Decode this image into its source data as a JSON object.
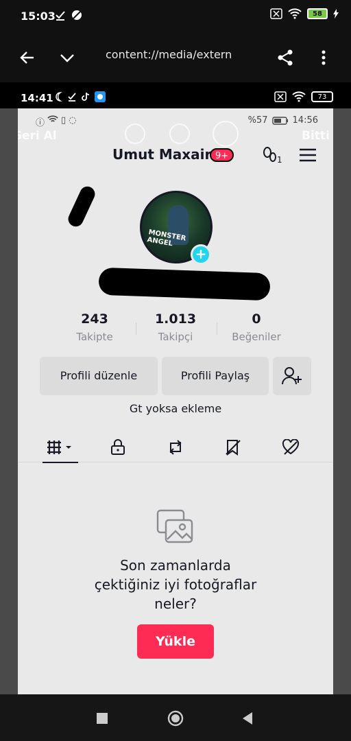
{
  "outer_status": {
    "time": "15:03",
    "battery": "58"
  },
  "browser": {
    "url": "content://media/extern"
  },
  "inner_status": {
    "time": "14:41",
    "battery": "73"
  },
  "tiktok_status": {
    "battery_percent": "%57",
    "time": "14:56"
  },
  "overlay": {
    "left_label": "Geri Al",
    "right_label": "Bitti"
  },
  "profile": {
    "username": "Umut Maxair",
    "notification_badge": "9+",
    "avatar_text": "MONSTER ANGEL",
    "stats": [
      {
        "value": "243",
        "label": "Takipte"
      },
      {
        "value": "1.013",
        "label": "Takipçi"
      },
      {
        "value": "0",
        "label": "Beğeniler"
      }
    ],
    "edit_button": "Profili düzenle",
    "share_button": "Profili Paylaş",
    "bio": "Gt yoksa ekleme"
  },
  "tabs": [
    {
      "icon": "grid-icon"
    },
    {
      "icon": "lock-icon"
    },
    {
      "icon": "repost-icon"
    },
    {
      "icon": "saved-icon"
    },
    {
      "icon": "liked-icon"
    }
  ],
  "empty_state": {
    "line1": "Son zamanlarda",
    "line2": "çektiğiniz iyi fotoğraflar",
    "line3": "neler?",
    "upload_button": "Yükle"
  },
  "colors": {
    "accent": "#fe2c55",
    "plus": "#20d5ec"
  }
}
